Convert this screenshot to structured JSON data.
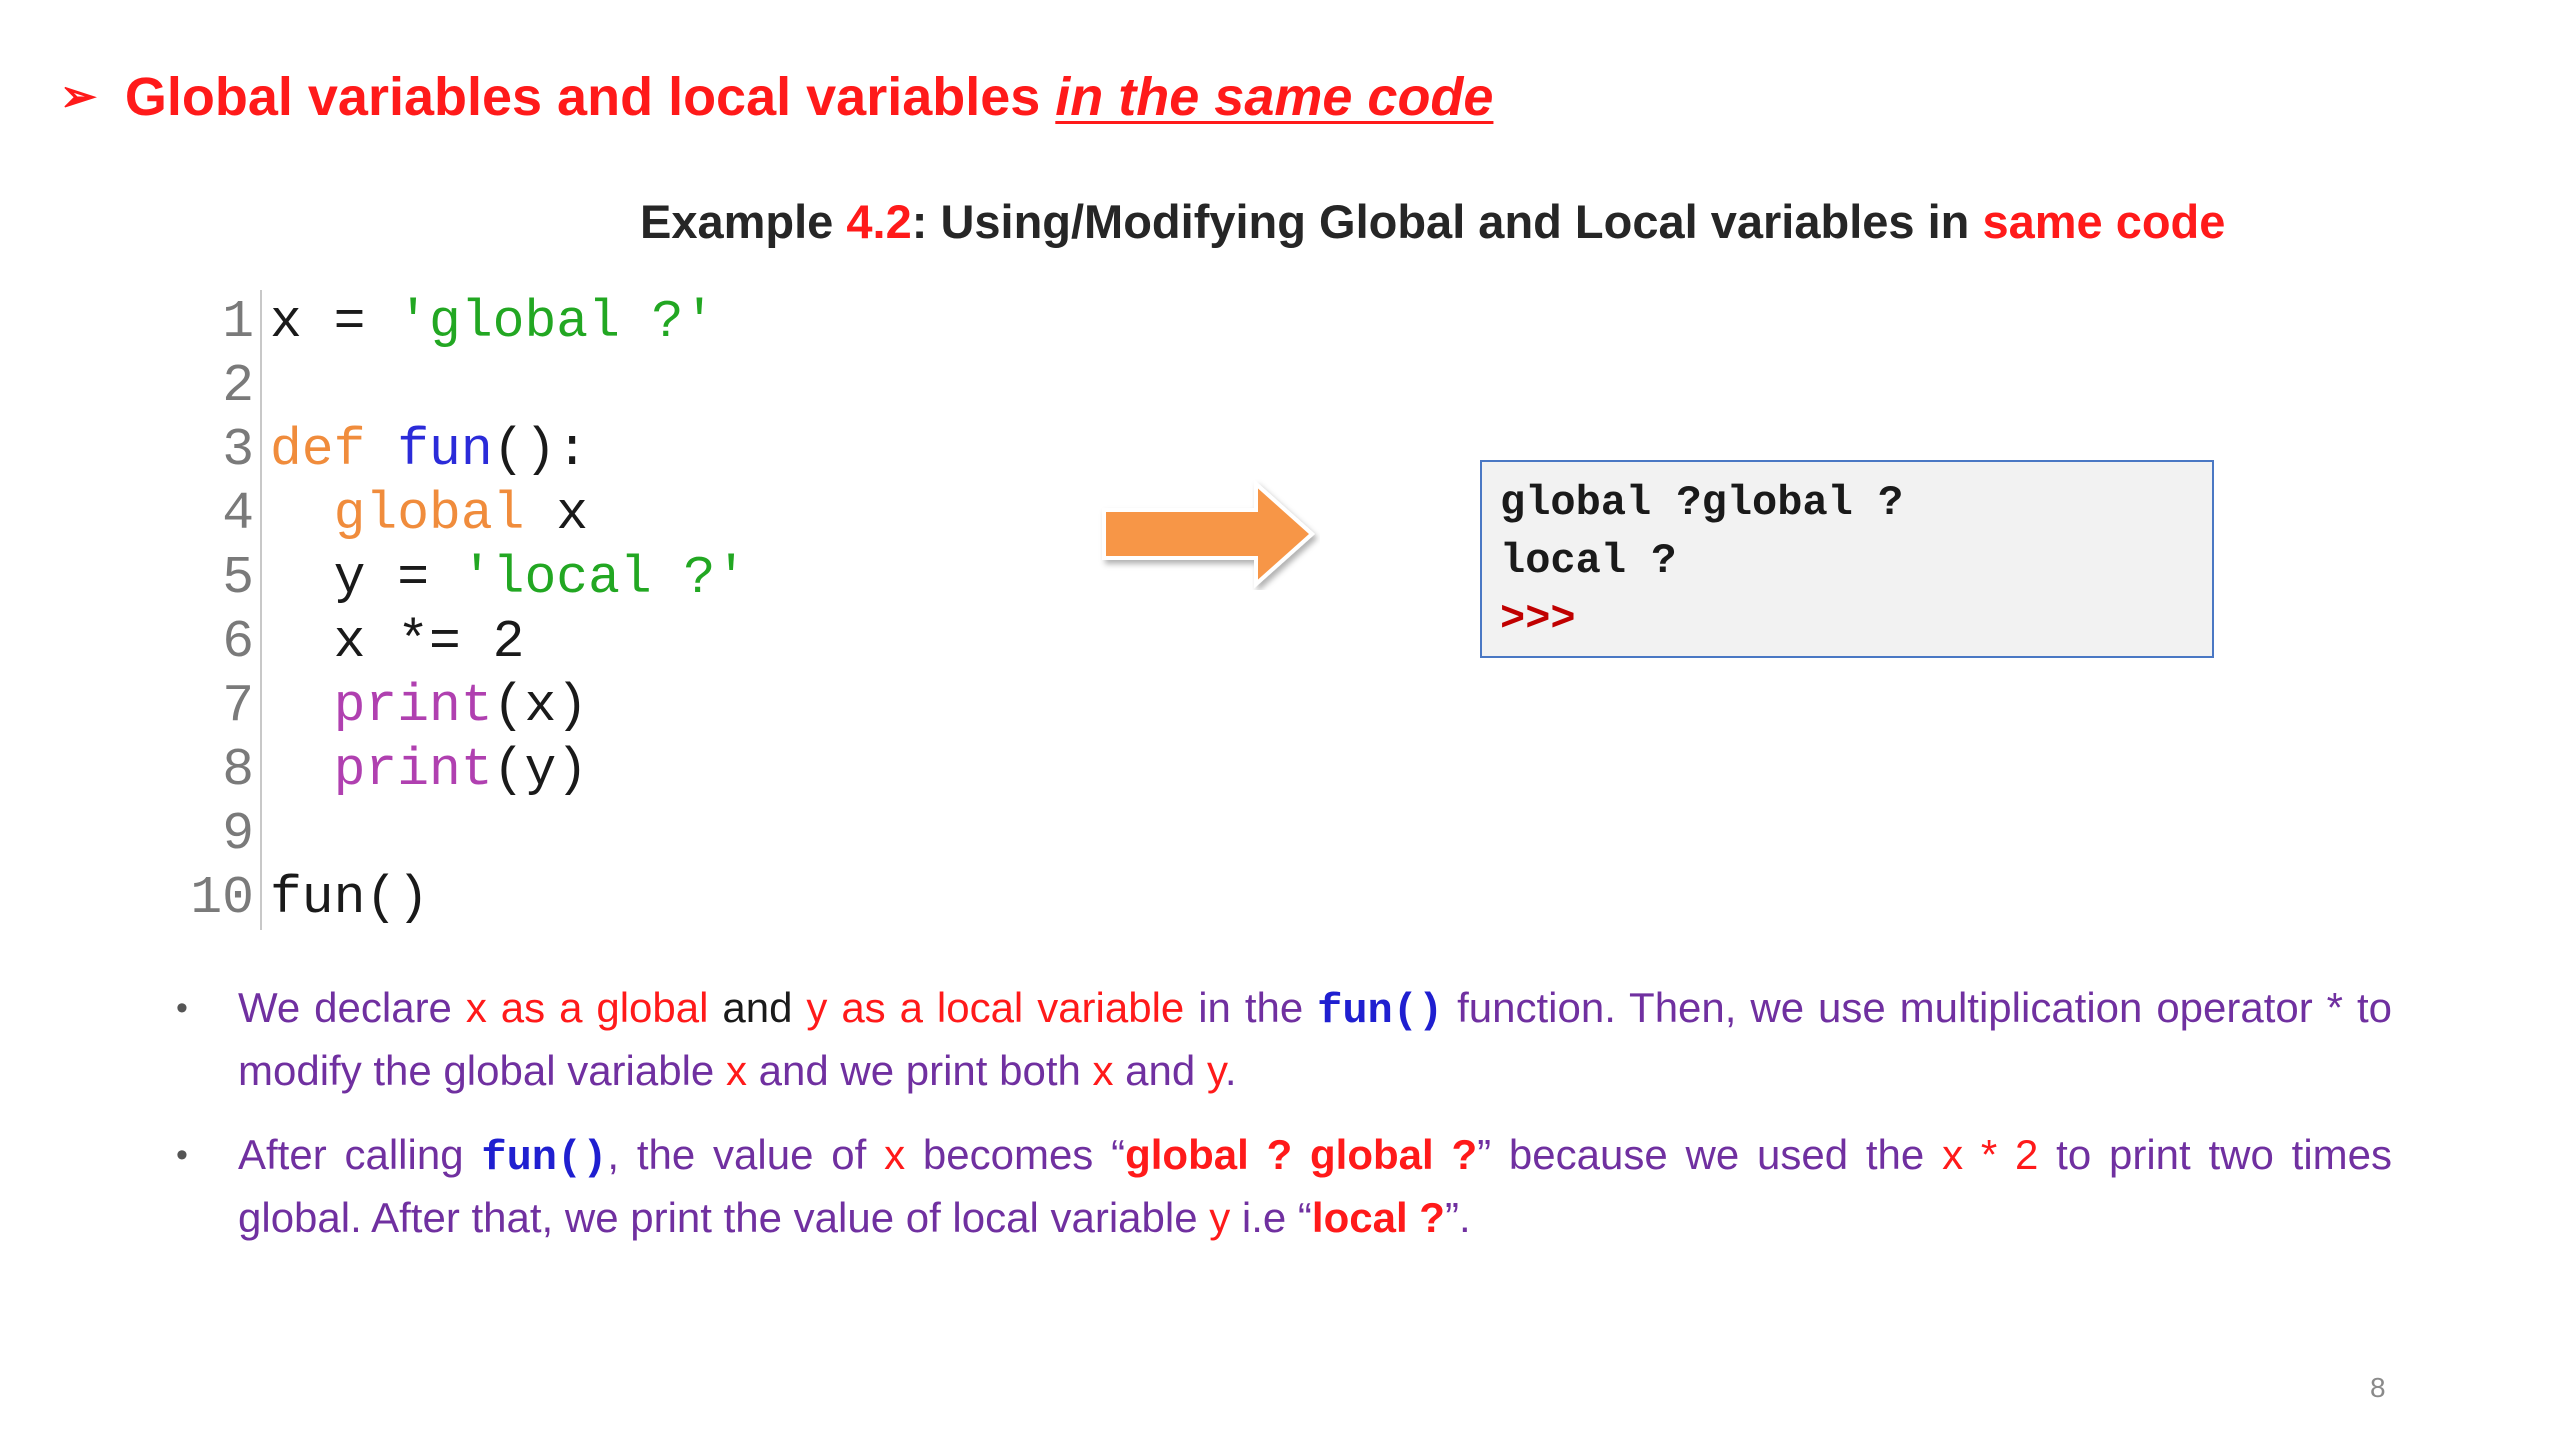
{
  "title": {
    "bullet": "➢",
    "text_main": "Global variables and local variables ",
    "text_emphasis": "in the same code"
  },
  "example_heading": {
    "part1": "Example ",
    "number": "4.2",
    "part2": ": Using/Modifying Global and Local variables in ",
    "part3": "same code"
  },
  "code": {
    "lines": [
      {
        "num": "1",
        "tokens": [
          {
            "text": "x = ",
            "type": "plain"
          },
          {
            "text": "'global ?'",
            "type": "str"
          }
        ]
      },
      {
        "num": "2",
        "tokens": []
      },
      {
        "num": "3",
        "tokens": [
          {
            "text": "def",
            "type": "kw"
          },
          {
            "text": " ",
            "type": "plain"
          },
          {
            "text": "fun",
            "type": "fn"
          },
          {
            "text": "():",
            "type": "plain"
          }
        ]
      },
      {
        "num": "4",
        "tokens": [
          {
            "text": "  ",
            "type": "plain"
          },
          {
            "text": "global",
            "type": "kw"
          },
          {
            "text": " x",
            "type": "plain"
          }
        ]
      },
      {
        "num": "5",
        "tokens": [
          {
            "text": "  y = ",
            "type": "plain"
          },
          {
            "text": "'local ?'",
            "type": "str"
          }
        ]
      },
      {
        "num": "6",
        "tokens": [
          {
            "text": "  x *= 2",
            "type": "plain"
          }
        ]
      },
      {
        "num": "7",
        "tokens": [
          {
            "text": "  ",
            "type": "plain"
          },
          {
            "text": "print",
            "type": "builtin"
          },
          {
            "text": "(x)",
            "type": "plain"
          }
        ]
      },
      {
        "num": "8",
        "tokens": [
          {
            "text": "  ",
            "type": "plain"
          },
          {
            "text": "print",
            "type": "builtin"
          },
          {
            "text": "(y)",
            "type": "plain"
          }
        ]
      },
      {
        "num": "9",
        "tokens": []
      },
      {
        "num": "10",
        "tokens": [
          {
            "text": "fun()",
            "type": "plain"
          }
        ]
      }
    ]
  },
  "output": {
    "line1": "global ?global ?",
    "line2": "local ?",
    "prompt": ">>>"
  },
  "bullets": {
    "b1": {
      "dot": "•",
      "s1": "We declare ",
      "s2": "x as a global",
      "s3": " and ",
      "s4": "y as a local variable",
      "s5": " in the ",
      "s6": "fun()",
      "s7": "  function. Then, we use multiplication operator * to modify the global variable ",
      "s8": "x",
      "s9": " and we print both ",
      "s10": "x",
      "s11": " and ",
      "s12": "y",
      "s13": "."
    },
    "b2": {
      "dot": "•",
      "s1": "After calling ",
      "s2": "fun()",
      "s3": ", the value of ",
      "s4": "x",
      "s5": " becomes “",
      "s6": "global ? global ?",
      "s7": "” because we used the ",
      "s8": "x * 2",
      "s9": " to print two times global. After that, we print the value of local variable ",
      "s10": "y",
      "s11": " i.e “",
      "s12": "local ?",
      "s13": "”."
    }
  },
  "colors": {
    "title_red": "#ff1a1a",
    "purple_text": "#7030a0",
    "code_string": "#22a722",
    "code_keyword": "#f08c3c",
    "code_function": "#2b2bd9",
    "code_builtin": "#b040b0",
    "arrow_orange": "#f79646",
    "output_border": "#4a78c4",
    "output_prompt": "#c00000"
  },
  "icons": {
    "arrow": "right-arrow-icon",
    "title_bullet": "arrowhead-bullet-icon"
  },
  "page_number": "8"
}
